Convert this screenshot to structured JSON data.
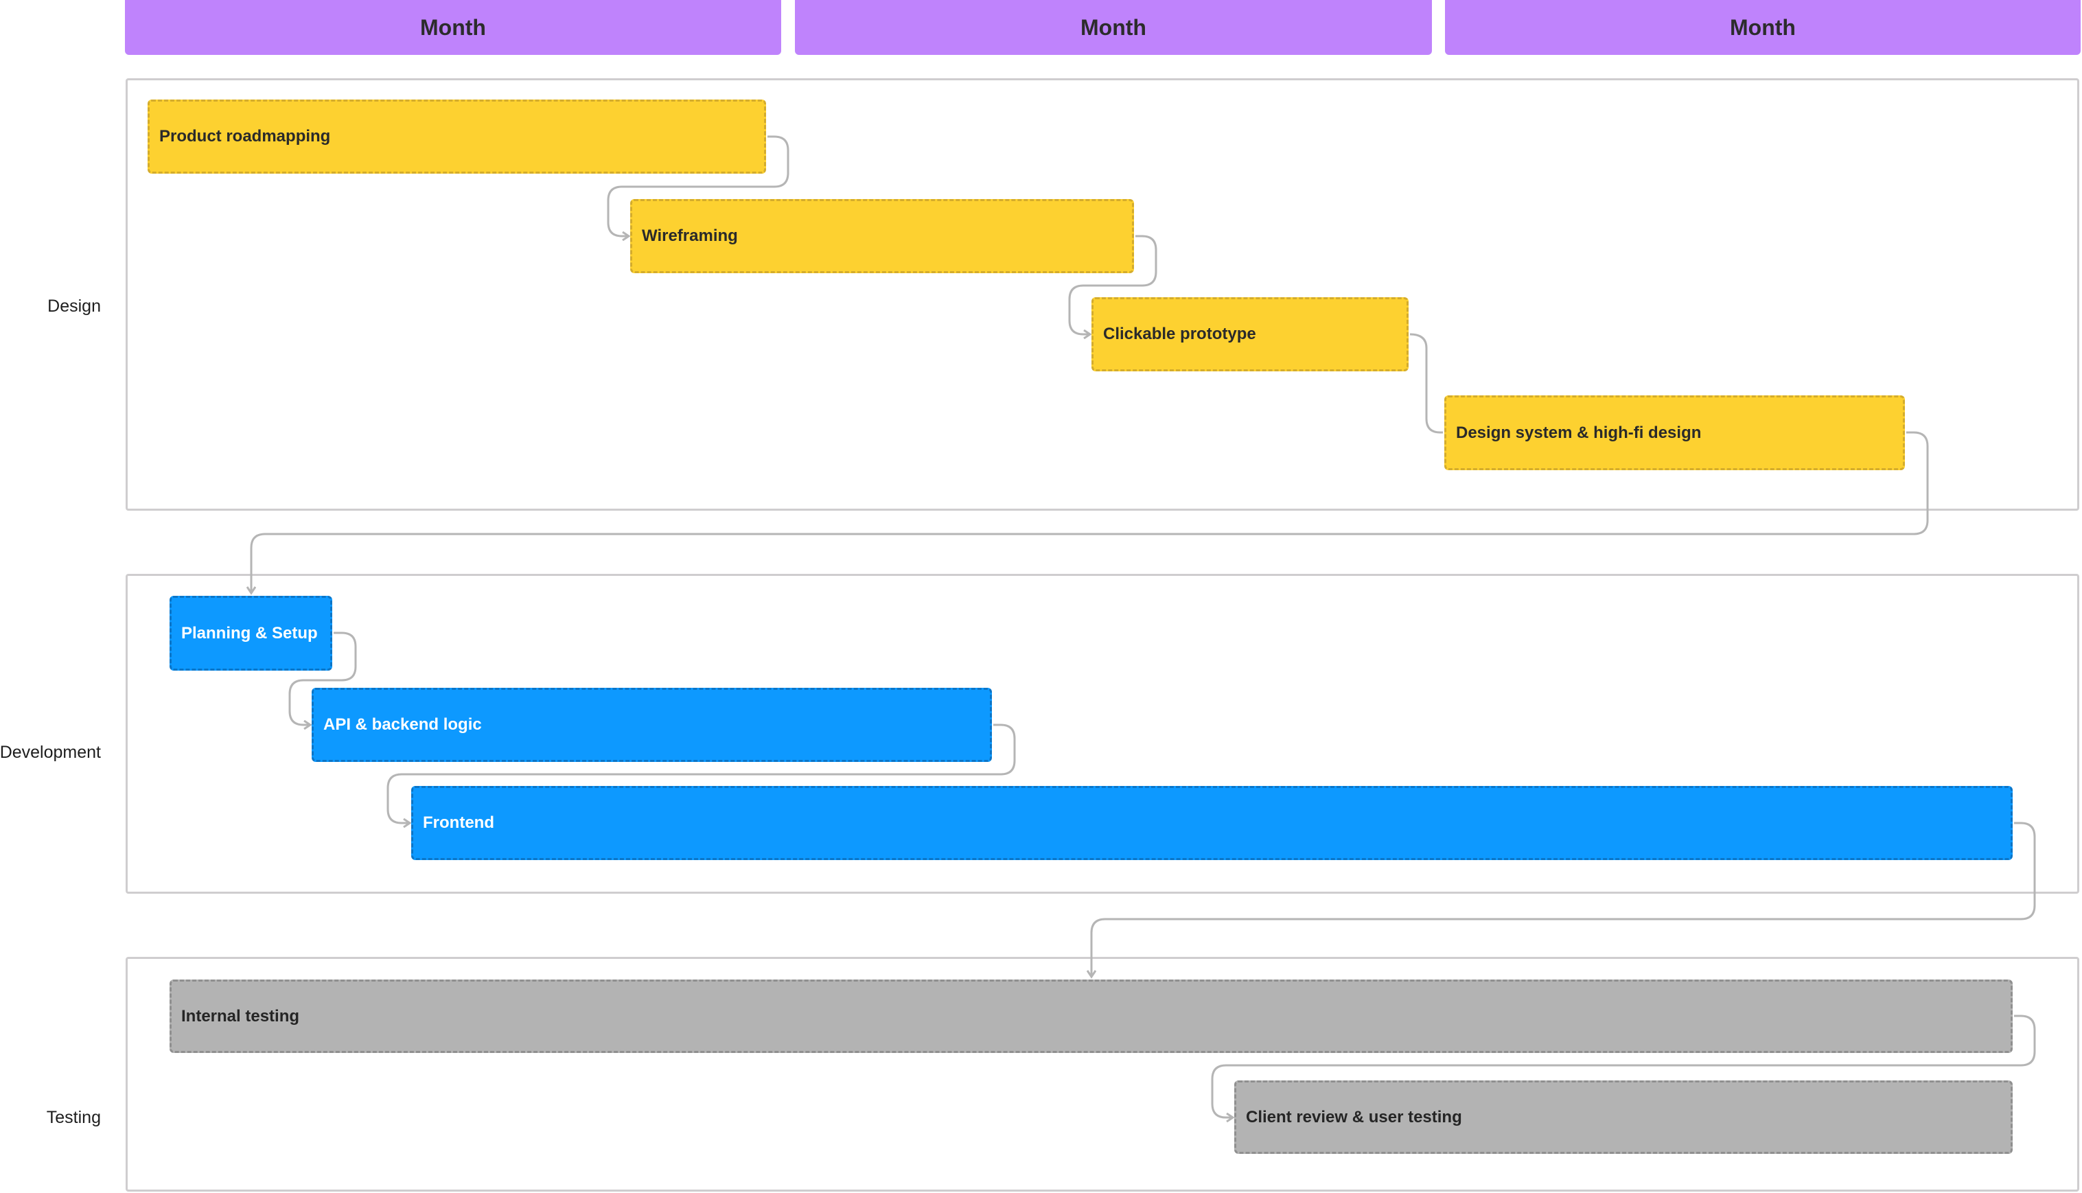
{
  "timeline": {
    "months": [
      "Month",
      "Month",
      "Month"
    ]
  },
  "lanes": [
    {
      "label": "Design",
      "color": "#fdd130"
    },
    {
      "label": "Development",
      "color": "#0d99ff"
    },
    {
      "label": "Testing",
      "color": "#b3b3b3"
    }
  ],
  "tasks": [
    {
      "label": "Product roadmapping",
      "lane": "Design"
    },
    {
      "label": "Wireframing",
      "lane": "Design"
    },
    {
      "label": "Clickable prototype",
      "lane": "Design"
    },
    {
      "label": "Design system & high-fi design",
      "lane": "Design"
    },
    {
      "label": "Planning & Setup",
      "lane": "Development"
    },
    {
      "label": "API & backend logic",
      "lane": "Development"
    },
    {
      "label": "Frontend",
      "lane": "Development"
    },
    {
      "label": "Internal testing",
      "lane": "Testing"
    },
    {
      "label": "Client review & user testing",
      "lane": "Testing"
    }
  ],
  "dependencies": [
    [
      "Product roadmapping",
      "Wireframing"
    ],
    [
      "Wireframing",
      "Clickable prototype"
    ],
    [
      "Clickable prototype",
      "Design system & high-fi design"
    ],
    [
      "Design system & high-fi design",
      "Planning & Setup"
    ],
    [
      "Planning & Setup",
      "API & backend logic"
    ],
    [
      "API & backend logic",
      "Frontend"
    ],
    [
      "Frontend",
      "Internal testing"
    ],
    [
      "Internal testing",
      "Client review & user testing"
    ]
  ],
  "colors": {
    "month_header": "#bf83fc",
    "connector": "#b5b5b5",
    "lane_border": "#cfcdcf"
  }
}
